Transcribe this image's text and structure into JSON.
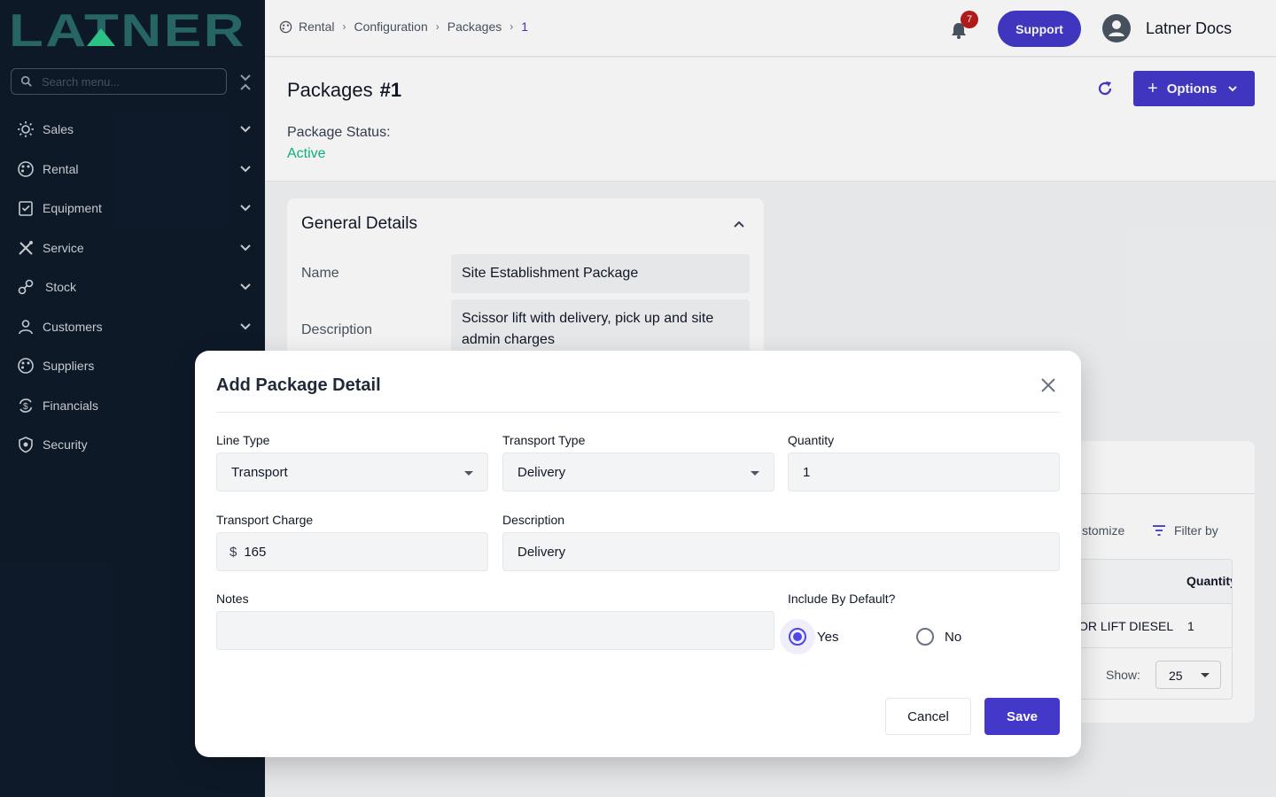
{
  "sidebar": {
    "logo_text": "LATNER",
    "search_placeholder": "Search menu...",
    "items": [
      {
        "label": "Sales",
        "icon": "sun-icon"
      },
      {
        "label": "Rental",
        "icon": "palette-icon"
      },
      {
        "label": "Equipment",
        "icon": "clipboard-check-icon"
      },
      {
        "label": "Service",
        "icon": "tools-icon"
      },
      {
        "label": "Stock",
        "icon": "boxes-icon"
      },
      {
        "label": "Customers",
        "icon": "person-icon"
      },
      {
        "label": "Suppliers",
        "icon": "palette-icon"
      },
      {
        "label": "Financials",
        "icon": "currency-cycle-icon"
      },
      {
        "label": "Security",
        "icon": "shield-icon"
      }
    ]
  },
  "topbar": {
    "breadcrumbs": [
      "Rental",
      "Configuration",
      "Packages",
      "1"
    ],
    "notification_count": "7",
    "support_label": "Support",
    "user_name": "Latner Docs"
  },
  "page": {
    "title": "Packages",
    "title_id": "#1",
    "options_label": "Options",
    "status_label": "Package Status:",
    "status_value": "Active",
    "status_color": "#10b981"
  },
  "general_details": {
    "title": "General Details",
    "name_label": "Name",
    "name_value": "Site Establishment Package",
    "description_label": "Description",
    "description_value": "Scissor lift with delivery, pick up and site admin charges"
  },
  "lines_card": {
    "customize_label": "stomize",
    "filter_label": "Filter by",
    "quantity_header": "Quantity",
    "rows": [
      {
        "item": "OR LIFT DIESEL",
        "quantity": "1"
      }
    ],
    "show_label": "Show:",
    "page_size": "25"
  },
  "modal": {
    "title": "Add Package Detail",
    "line_type_label": "Line Type",
    "line_type_value": "Transport",
    "transport_type_label": "Transport Type",
    "transport_type_value": "Delivery",
    "quantity_label": "Quantity",
    "quantity_value": "1",
    "transport_charge_label": "Transport Charge",
    "currency_symbol": "$",
    "transport_charge_value": "165",
    "description_label": "Description",
    "description_value": "Delivery",
    "notes_label": "Notes",
    "notes_value": "",
    "include_default_label": "Include By Default?",
    "yes_label": "Yes",
    "no_label": "No",
    "selected": "Yes",
    "cancel_label": "Cancel",
    "save_label": "Save"
  },
  "colors": {
    "sidebar_bg": "#0f1b2b",
    "primary": "#4338ca",
    "logo_teal": "#2a6b6b",
    "logo_accent": "#2ecc8f",
    "badge": "#b91c1c"
  }
}
